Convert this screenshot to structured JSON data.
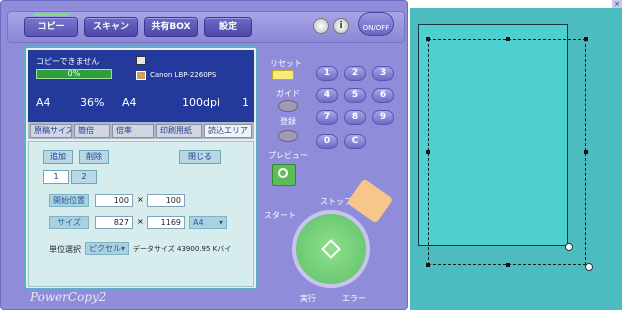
{
  "tabs": [
    "コピー",
    "スキャン",
    "共有BOX",
    "設定"
  ],
  "power_label": "ON/OFF",
  "status": {
    "state": "コピーできません",
    "progress_text": "0%",
    "progress_fraction": 0.0,
    "printer": "Canon LBP-2260PS",
    "paper_in": "A4",
    "zoom": "36%",
    "paper_out": "A4",
    "dpi": "100dpi",
    "copies": "1"
  },
  "func_tabs": [
    "原稿サイズ",
    "簡倍",
    "倍率",
    "印刷用紙",
    "読込エリア"
  ],
  "subpanel": {
    "add": "追加",
    "delete": "削除",
    "close": "閉じる",
    "pages": [
      "1",
      "2"
    ],
    "start_label": "開始位置",
    "start_x": "100",
    "start_y": "100",
    "size_label": "サイズ",
    "size_w": "827",
    "size_h": "1169",
    "size_paper": "A4",
    "x_sep": "×",
    "unit_label": "単位選択",
    "unit_value": "ピクセル",
    "data_size": "データサイズ 43900.95 Kバイ"
  },
  "controls": {
    "reset": "リセット",
    "guide": "ガイド",
    "save": "登録",
    "preview": "プレビュー",
    "start": "スタート",
    "stop": "ストップ",
    "run": "実行",
    "error": "エラー",
    "keys": [
      "1",
      "2",
      "3",
      "4",
      "5",
      "6",
      "7",
      "8",
      "9",
      "0",
      "C"
    ]
  },
  "logo": "PowerCopy2",
  "colors": {
    "accent": "#8f8cd9",
    "preview_bg": "#4dbcc0",
    "status_bg": "#233a9c"
  }
}
